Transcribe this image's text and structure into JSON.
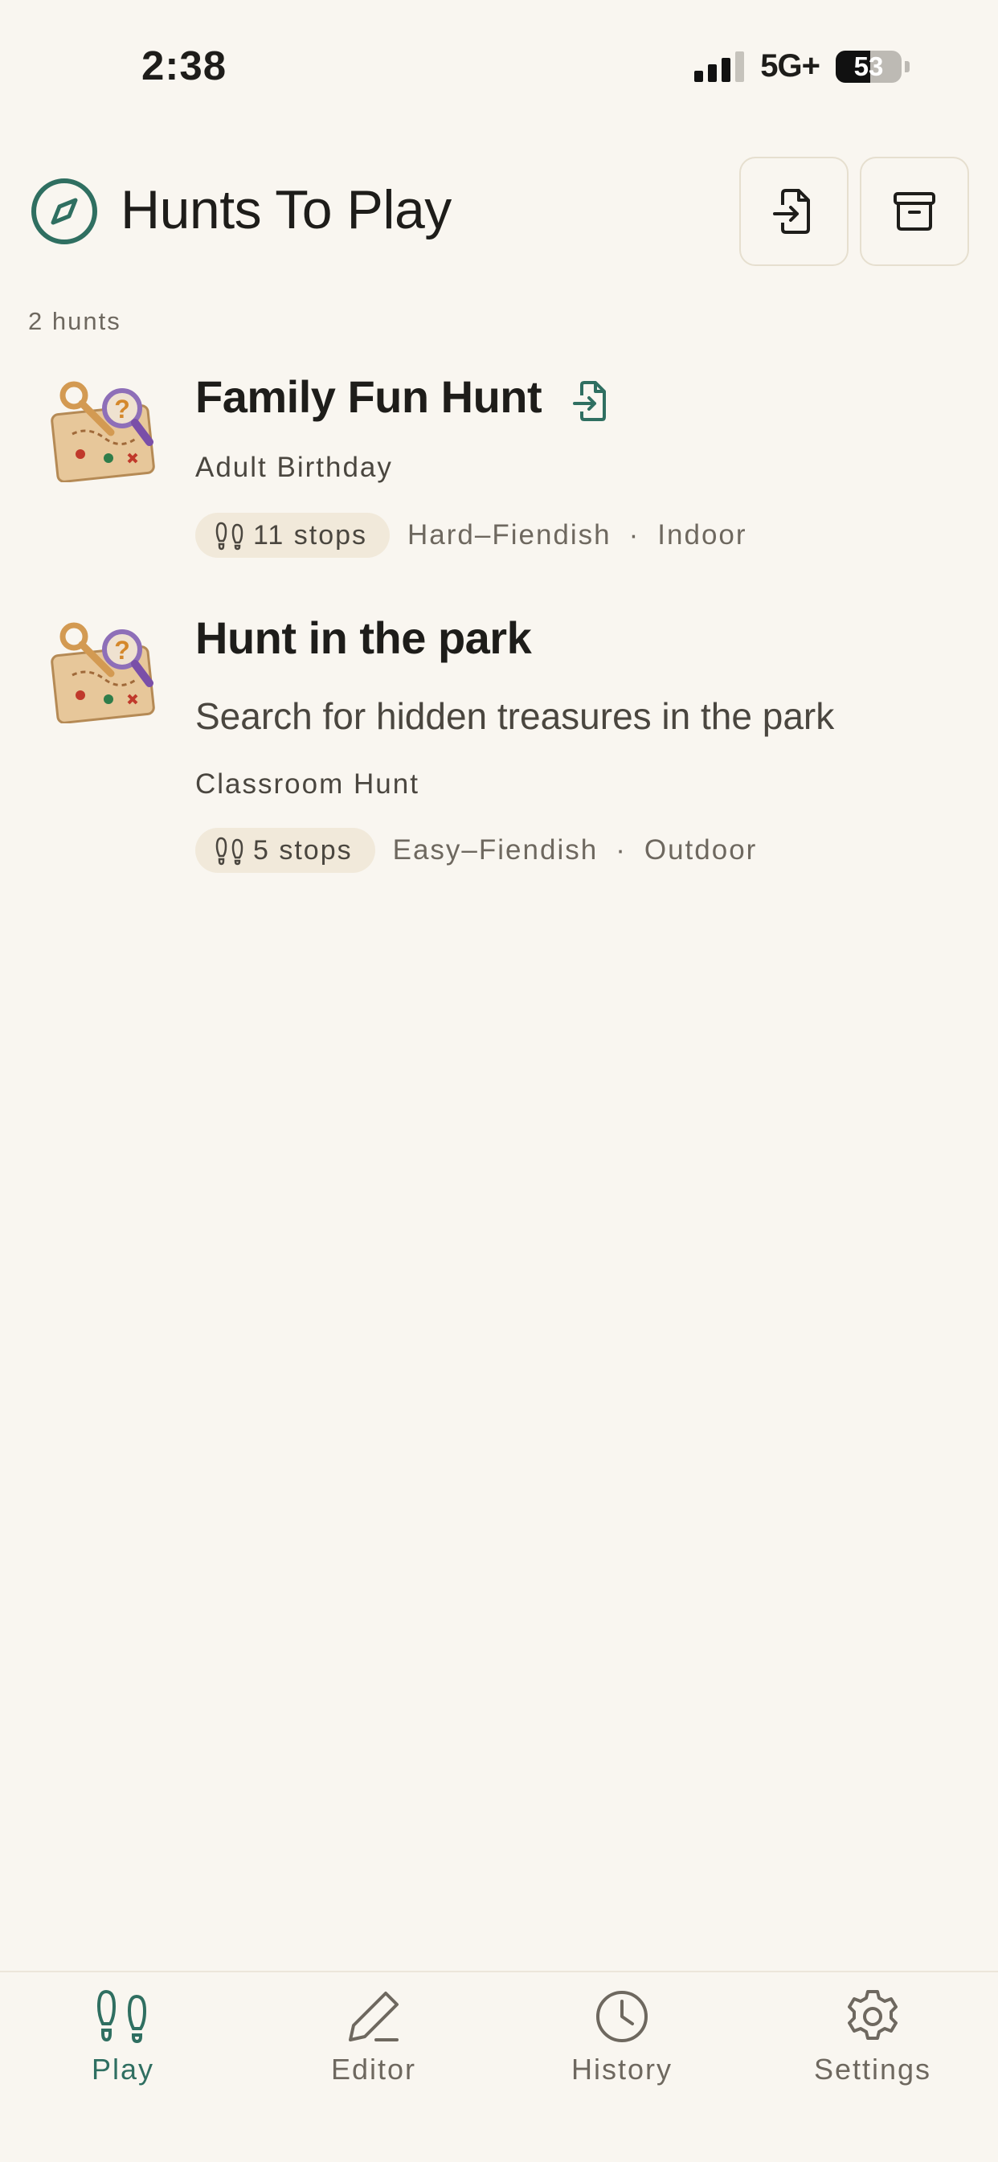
{
  "status_bar": {
    "time": "2:38",
    "network": "5G+",
    "battery": "53",
    "battery_level": 0.53
  },
  "header": {
    "title": "Hunts To Play",
    "icon": "compass-icon",
    "actions": [
      "import-icon",
      "archive-icon"
    ]
  },
  "hunt_count": "2 hunts",
  "hunts": [
    {
      "title": "Family Fun Hunt",
      "has_import_badge": true,
      "description": "",
      "category": "Adult Birthday",
      "stops": "11 stops",
      "difficulty": "Hard–Fiendish",
      "location": "Indoor"
    },
    {
      "title": "Hunt in the park",
      "has_import_badge": false,
      "description": "Search for hidden treasures in the park",
      "category": "Classroom Hunt",
      "stops": "5 stops",
      "difficulty": "Easy–Fiendish",
      "location": "Outdoor"
    }
  ],
  "tabs": [
    {
      "label": "Play",
      "icon": "footprints-icon",
      "active": true
    },
    {
      "label": "Editor",
      "icon": "pencil-icon",
      "active": false
    },
    {
      "label": "History",
      "icon": "clock-icon",
      "active": false
    },
    {
      "label": "Settings",
      "icon": "gear-icon",
      "active": false
    }
  ],
  "colors": {
    "accent": "#2f6f61",
    "background": "#f9f6f0",
    "muted": "#6e685f",
    "pill": "#f1e9da"
  }
}
